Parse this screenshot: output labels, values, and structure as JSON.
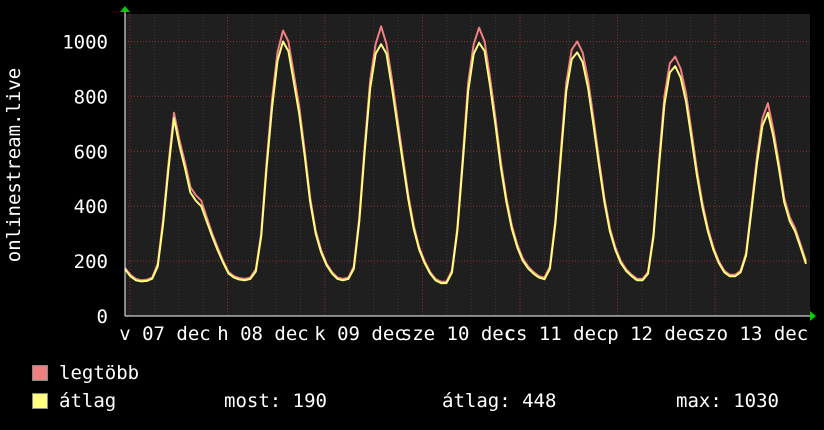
{
  "chart_data": {
    "type": "line",
    "ylabel": "onlinestream.live",
    "ylim": [
      0,
      1100
    ],
    "yticks": [
      0,
      200,
      400,
      600,
      800,
      1000
    ],
    "xtick_labels": [
      "v 07 dec",
      "h 08 dec",
      "k 09 dec",
      "sze 10 dec",
      "cs 11 dec",
      "p 12 dec",
      "szo 13 dec"
    ],
    "grid": true,
    "background": "#1f1f1f",
    "series": [
      {
        "name": "legtöbb",
        "color": "#f07f7f",
        "day_peaks": [
          755,
          1050,
          1060,
          1050,
          1000,
          950,
          775
        ],
        "values": [
          175,
          150,
          135,
          130,
          132,
          140,
          190,
          350,
          560,
          740,
          640,
          560,
          470,
          440,
          420,
          360,
          300,
          250,
          200,
          160,
          145,
          138,
          135,
          140,
          170,
          300,
          560,
          790,
          960,
          1040,
          1000,
          880,
          760,
          600,
          430,
          310,
          240,
          190,
          160,
          140,
          135,
          140,
          180,
          360,
          620,
          860,
          990,
          1055,
          990,
          860,
          720,
          580,
          440,
          330,
          250,
          200,
          160,
          135,
          125,
          125,
          165,
          320,
          580,
          850,
          990,
          1050,
          1000,
          870,
          720,
          560,
          430,
          330,
          260,
          210,
          180,
          160,
          145,
          140,
          180,
          350,
          600,
          850,
          970,
          1000,
          960,
          860,
          720,
          570,
          430,
          320,
          250,
          200,
          170,
          150,
          135,
          135,
          160,
          300,
          560,
          800,
          920,
          945,
          900,
          810,
          670,
          530,
          410,
          320,
          250,
          200,
          165,
          150,
          150,
          165,
          230,
          400,
          580,
          720,
          775,
          680,
          560,
          430,
          360,
          320,
          260,
          200
        ]
      },
      {
        "name": "átlag",
        "color": "#ffff7f",
        "values": [
          170,
          145,
          130,
          126,
          128,
          136,
          180,
          335,
          540,
          720,
          620,
          540,
          450,
          420,
          400,
          345,
          290,
          240,
          195,
          155,
          140,
          133,
          130,
          135,
          162,
          290,
          540,
          760,
          930,
          1000,
          965,
          850,
          735,
          580,
          415,
          300,
          232,
          185,
          155,
          135,
          130,
          135,
          172,
          345,
          600,
          830,
          955,
          990,
          955,
          830,
          695,
          560,
          425,
          318,
          242,
          193,
          155,
          130,
          120,
          120,
          158,
          308,
          560,
          820,
          955,
          995,
          965,
          840,
          695,
          540,
          415,
          318,
          250,
          202,
          173,
          154,
          140,
          134,
          172,
          337,
          578,
          820,
          935,
          960,
          925,
          830,
          695,
          550,
          415,
          308,
          242,
          193,
          164,
          145,
          130,
          130,
          154,
          289,
          540,
          770,
          887,
          910,
          868,
          780,
          645,
          510,
          395,
          308,
          241,
          193,
          159,
          145,
          145,
          159,
          221,
          385,
          558,
          693,
          740,
          655,
          540,
          415,
          346,
          308,
          250,
          190
        ]
      }
    ]
  },
  "legend": {
    "max_label": "legtöbb",
    "avg_label": "átlag",
    "max_color": "#f07f7f",
    "avg_color": "#ffff7f"
  },
  "stats": {
    "now": "most: 190",
    "avg": "átlag: 448",
    "max": "max: 1030"
  }
}
